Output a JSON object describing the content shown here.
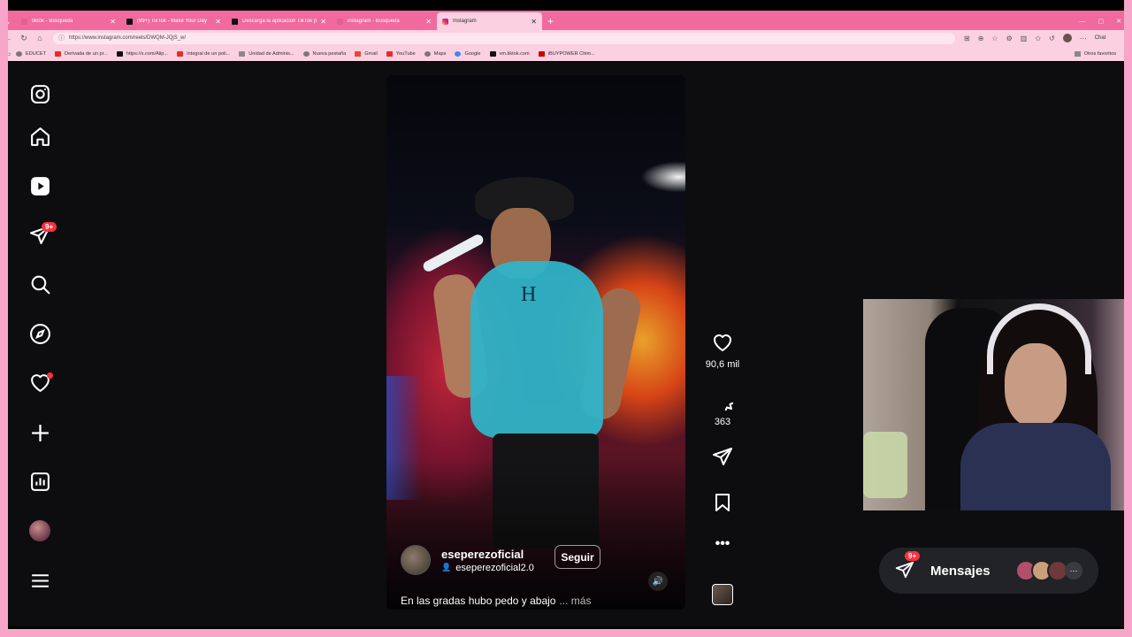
{
  "browser": {
    "tabs": [
      {
        "title": "tiktok - Búsqueda",
        "icon": "pink"
      },
      {
        "title": "(99+) TikTok - Make Your Day",
        "icon": "tiktok"
      },
      {
        "title": "Descarga la aplicación TikTok para...",
        "icon": "tiktok"
      },
      {
        "title": "instagram - Búsqueda",
        "icon": "pink"
      },
      {
        "title": "Instagram",
        "icon": "instagram"
      }
    ],
    "url": "https://www.instagram.com/reels/DWQM-JQjS_w/",
    "bookmarks": [
      {
        "label": "EDUCET",
        "icon": "globe"
      },
      {
        "label": "Derivada de un pr...",
        "icon": "youtube"
      },
      {
        "label": "https://x.com/Alip...",
        "icon": "x"
      },
      {
        "label": "Integral de un poli...",
        "icon": "youtube"
      },
      {
        "label": "Unidad de Adminis...",
        "icon": "generic"
      },
      {
        "label": "Nueva pestaña",
        "icon": "globe"
      },
      {
        "label": "Gmail",
        "icon": "gmail"
      },
      {
        "label": "YouTube",
        "icon": "youtube"
      },
      {
        "label": "Maps",
        "icon": "maps"
      },
      {
        "label": "Google",
        "icon": "google"
      },
      {
        "label": "vm.tiktok.com",
        "icon": "tiktok"
      },
      {
        "label": "iBUYPOWER Chim...",
        "icon": "ibuypower"
      }
    ],
    "other_bookmarks": "Otros favoritos",
    "chat_label": "Chat"
  },
  "sidebar": {
    "notifications_badge": "9+"
  },
  "reel": {
    "username": "eseperezoficial",
    "tagged_user": "eseperezoficial2.0",
    "follow_label": "Seguir",
    "caption": "En las gradas hubo pedo y abajo",
    "more_label": "... más",
    "likes": "90,6 mil",
    "comments": "363"
  },
  "messages": {
    "label": "Mensajes",
    "badge": "9+"
  },
  "colors": {
    "chrome_pink": "#f06a9e",
    "chrome_light": "#fbd0e1",
    "ig_bg": "#0d0d0f",
    "notification_red": "#ff3040"
  }
}
